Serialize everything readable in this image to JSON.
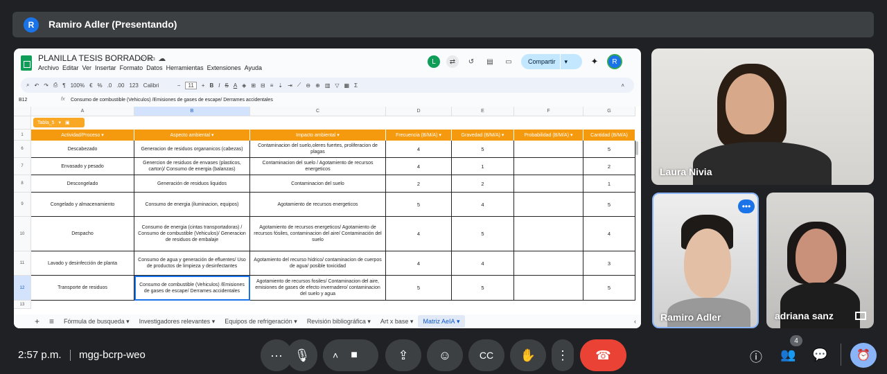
{
  "presenter": {
    "initial": "R",
    "label": "Ramiro Adler (Presentando)"
  },
  "sheet": {
    "title": "PLANILLA TESIS BORRADOR",
    "menu": [
      "Archivo",
      "Editar",
      "Ver",
      "Insertar",
      "Formato",
      "Datos",
      "Herramientas",
      "Extensiones",
      "Ayuda"
    ],
    "share_label": "Compartir",
    "user_initial": "L",
    "owner_initial": "R",
    "toolbar": {
      "zoom": "100%",
      "currency": "€",
      "percent": "%",
      "dec_minus": ".0",
      "dec_plus": ".00",
      "format123": "123",
      "font": "Calibri",
      "font_size": "11"
    },
    "namebox": "B12",
    "formula": "Consumo de combustible (Vehiculos) /Emisiones de gases de escape/ Derrames accidentales",
    "columns": [
      "A",
      "B",
      "C",
      "D",
      "E",
      "F",
      "G"
    ],
    "table_chip": "Tabla_5",
    "headers": [
      "Actividad/Proceso",
      "Aspecto ambiental",
      "Impacto ambiental",
      "Frecuencia (B/M/A)",
      "Gravedad (B/M/A)",
      "Probabilidad (B/M/A)",
      "Cantidad (B/M/A)"
    ],
    "header_row": "1",
    "rows": [
      {
        "n": "6",
        "a": "Descabezado",
        "b": "Generacion de residuos organanicos (cabezas)",
        "c": "Contaminacion del suelo,oleres fuertes, proliferacion de plagas",
        "d": "4",
        "e": "5",
        "f": "",
        "g": "5"
      },
      {
        "n": "7",
        "a": "Envasado y pesado",
        "b": "Genercion de residuos de envases (plasticos, carton)/ Consumo de energia (balanzas)",
        "c": "Contaminacion del suelo / Agotamiento de recursos energeticos",
        "d": "4",
        "e": "1",
        "f": "",
        "g": "2"
      },
      {
        "n": "8",
        "a": "Descongelado",
        "b": "Generación de residuos liquidos",
        "c": "Contaminacion del suelo",
        "d": "2",
        "e": "2",
        "f": "",
        "g": "1"
      },
      {
        "n": "9",
        "a": "Congelado y almacenamiento",
        "b": "Consumo de energia (iluminacion, equipos)",
        "c": "Agotamiento de recursos energeticos",
        "d": "5",
        "e": "4",
        "f": "",
        "g": "5"
      },
      {
        "n": "10",
        "a": "Despacho",
        "b": "Consumo de energia (cintas transportadoras) / Consumo de combustible (Vehiculos)/ Generacion de residuos de embalaje",
        "c": "Agotamiento de recursos energeticos/ Agotamiento de recursos fósiles, contaminacion del aire/ Contaminación del suelo",
        "d": "4",
        "e": "5",
        "f": "",
        "g": "4"
      },
      {
        "n": "11",
        "a": "Lavado y desinfección de planta",
        "b": "Consumo de agua y generación de efluentes/ Uso de productos de limpieza y desinfectantes",
        "c": "Agotamiento del recurso hídrico/ contaminacion de cuerpos de agua/ posible toxicidad",
        "d": "4",
        "e": "4",
        "f": "",
        "g": "3"
      },
      {
        "n": "12",
        "a": "Transporte de residuos",
        "b": "Consumo de combustible (Vehiculos) /Emisiones de gases de escape/ Derrames accidentales",
        "c": "Agotamiento de recursos fosiles/ Contaminacion del aire, emisiones de gases de efecto invernadero/ contaminacion del suelo y agua",
        "d": "5",
        "e": "5",
        "f": "",
        "g": "5"
      },
      {
        "n": "13",
        "a": "",
        "b": "",
        "c": "",
        "d": "",
        "e": "",
        "f": "",
        "g": ""
      }
    ],
    "tabs": [
      "Fórmula de busqueda",
      "Investigadores relevantes",
      "Equipos de refrigeración",
      "Revisión bibliográfica",
      "Art x base",
      "Matriz AeIA"
    ]
  },
  "participants": [
    "Laura Nivia",
    "Ramiro Adler",
    "adriana sanz"
  ],
  "bottom": {
    "time": "2:57 p.m.",
    "meeting_code": "mgg-bcrp-weo",
    "people_count": "4"
  }
}
